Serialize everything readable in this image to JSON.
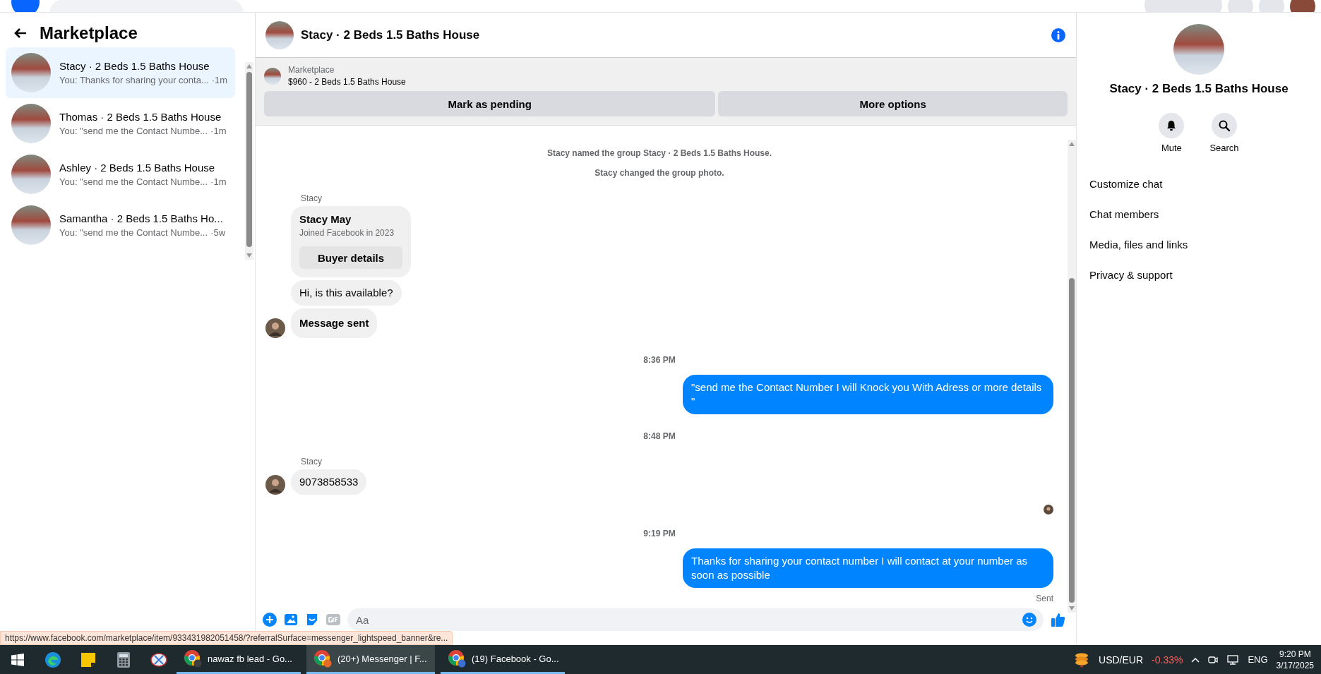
{
  "sidebar": {
    "title": "Marketplace",
    "conversations": [
      {
        "name": "Stacy · 2 Beds 1.5 Baths House",
        "preview": "You: Thanks for sharing your conta...",
        "time": "·1m",
        "selected": true
      },
      {
        "name": "Thomas · 2 Beds 1.5 Baths House",
        "preview": "You: \"send me the Contact Numbe...",
        "time": "·1m",
        "selected": false
      },
      {
        "name": "Ashley · 2 Beds 1.5 Baths House",
        "preview": "You: \"send me the Contact Numbe...",
        "time": "·1m",
        "selected": false
      },
      {
        "name": "Samantha · 2 Beds 1.5 Baths Ho...",
        "preview": "You: \"send me the Contact Numbe...",
        "time": "·5w",
        "selected": false
      }
    ]
  },
  "chat": {
    "title": "Stacy · 2 Beds 1.5 Baths House",
    "listing": {
      "label": "Marketplace",
      "title": "$960 - 2 Beds 1.5 Baths House",
      "actions": [
        "Mark as pending",
        "More options"
      ]
    },
    "messages": [
      {
        "kind": "system",
        "text": "Stacy named the group Stacy · 2 Beds 1.5 Baths House."
      },
      {
        "kind": "system",
        "text": "Stacy changed the group photo."
      },
      {
        "kind": "sender",
        "text": "Stacy"
      },
      {
        "kind": "card",
        "name": "Stacy May",
        "subtitle": "Joined Facebook in 2023",
        "button": "Buyer details"
      },
      {
        "kind": "incoming",
        "text": "Hi, is this available?",
        "bold": false,
        "avatar": false
      },
      {
        "kind": "incoming",
        "text": "Message sent",
        "bold": true,
        "avatar": true
      },
      {
        "kind": "time",
        "text": "8:36 PM"
      },
      {
        "kind": "outgoing",
        "text": "\"send me the Contact Number I will Knock you With Adress or more details \""
      },
      {
        "kind": "time",
        "text": "8:48 PM"
      },
      {
        "kind": "sender",
        "text": "Stacy"
      },
      {
        "kind": "incoming",
        "text": "9073858533",
        "bold": false,
        "avatar": true
      },
      {
        "kind": "seen"
      },
      {
        "kind": "time",
        "text": "9:19 PM"
      },
      {
        "kind": "outgoing",
        "text": "Thanks for sharing your contact number I will contact at your number as soon as possible"
      },
      {
        "kind": "status",
        "text": "Sent"
      }
    ],
    "composer": {
      "placeholder": "Aa"
    }
  },
  "details": {
    "title": "Stacy · 2 Beds 1.5 Baths House",
    "actions": [
      {
        "kind": "mute",
        "label": "Mute"
      },
      {
        "kind": "search",
        "label": "Search"
      }
    ],
    "menu": [
      "Customize chat",
      "Chat members",
      "Media, files and links",
      "Privacy & support"
    ]
  },
  "status_url": "https://www.facebook.com/marketplace/item/933431982051458/?referralSurface=messenger_lightspeed_banner&re...",
  "taskbar": {
    "windows": [
      {
        "label": "nawaz fb lead - Go...",
        "selected": false
      },
      {
        "label": "(20+) Messenger | F...",
        "selected": true
      },
      {
        "label": "(19) Facebook - Go...",
        "selected": false
      }
    ],
    "ticker": {
      "pair": "USD/EUR",
      "change": "-0.33%"
    },
    "language": "ENG",
    "time": "9:20 PM",
    "date": "3/17/2025"
  }
}
